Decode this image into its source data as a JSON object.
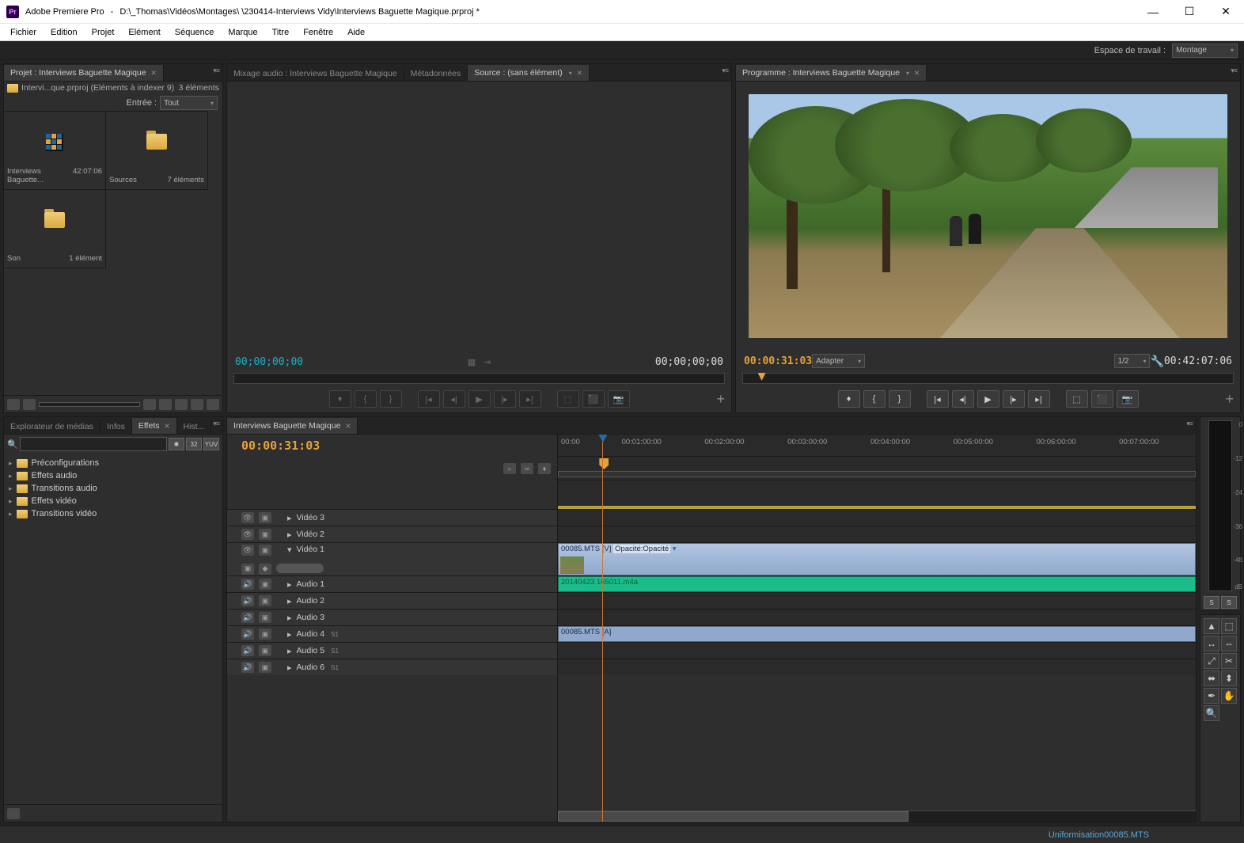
{
  "titlebar": {
    "app": "Adobe Premiere Pro",
    "path": "D:\\_Thomas\\Vidéos\\Montages\\                              \\230414-Interviews Vidy\\Interviews Baguette Magique.prproj *"
  },
  "menu": [
    "Fichier",
    "Edition",
    "Projet",
    "Elément",
    "Séquence",
    "Marque",
    "Titre",
    "Fenêtre",
    "Aide"
  ],
  "workspace": {
    "label": "Espace de travail :",
    "value": "Montage"
  },
  "project": {
    "tab": "Projet : Interviews Baguette Magique",
    "sub_left": "Intervi...que.prproj (Eléments à indexer 9)",
    "sub_right": "3 éléments",
    "filter_label": "Entrée :",
    "filter_value": "Tout",
    "bins": [
      {
        "name": "Interviews Baguette...",
        "meta": "42:07:06",
        "type": "sequence"
      },
      {
        "name": "Sources",
        "meta": "7 éléments",
        "type": "folder"
      },
      {
        "name": "Son",
        "meta": "1 élément",
        "type": "folder"
      }
    ]
  },
  "source": {
    "tabs": [
      "Mixage audio : Interviews Baguette Magique",
      "Métadonnées",
      "Source : (sans élément)"
    ],
    "active": 2,
    "tc_in": "00;00;00;00",
    "tc_out": "00;00;00;00"
  },
  "program": {
    "tab": "Programme : Interviews Baguette Magique",
    "tc_left": "00:00:31:03",
    "fit": "Adapter",
    "zoom": "1/2",
    "tc_right": "00:42:07:06"
  },
  "explorer_tabs": [
    "Explorateur de médias",
    "Infos",
    "Effets",
    "Hist..."
  ],
  "explorer_active": 2,
  "effects": {
    "search": "",
    "items": [
      "Préconfigurations",
      "Effets audio",
      "Transitions audio",
      "Effets vidéo",
      "Transitions vidéo"
    ],
    "badges": [
      "✱",
      "32",
      "YUV"
    ]
  },
  "timeline": {
    "tab": "Interviews Baguette Magique",
    "tc": "00:00:31:03",
    "ruler": [
      "00:00",
      "00:01:00:00",
      "00:02:00:00",
      "00:03:00:00",
      "00:04:00:00",
      "00:05:00:00",
      "00:06:00:00",
      "00:07:00:00"
    ],
    "video_tracks": [
      "Vidéo 3",
      "Vidéo 2",
      "Vidéo 1"
    ],
    "audio_tracks": [
      "Audio 1",
      "Audio 2",
      "Audio 3",
      "Audio 4",
      "Audio 5",
      "Audio 6"
    ],
    "clips": {
      "v1_name": "00085.MTS",
      "v1_tag": "[V]",
      "v1_fx": "Opacité:Opacité",
      "a1_name": "20140423 165011.m4a",
      "a4_name": "00085.MTS",
      "a4_tag": "[A]"
    },
    "track_marker": "S1"
  },
  "meter": {
    "scale": [
      "0",
      "-12",
      "-24",
      "-36",
      "-48",
      "dB"
    ],
    "btn": "S"
  },
  "status": "Uniformisation00085.MTS"
}
